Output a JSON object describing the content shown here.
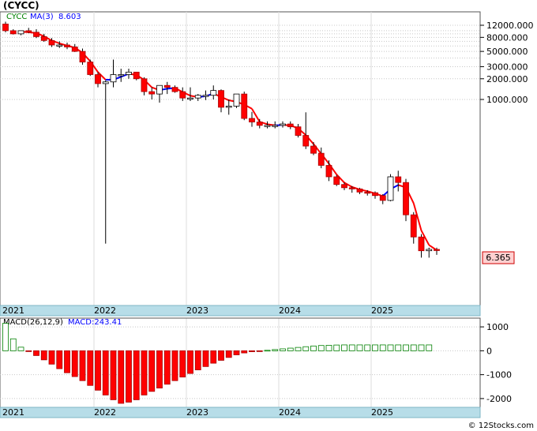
{
  "header": {
    "title": "(CYCC)"
  },
  "legend": {
    "ticker": "CYCC",
    "ma_label": "MA(3)",
    "ma_value": "8.603"
  },
  "price_panel": {
    "last_price_label": "6.365",
    "yaxis_labels": [
      "12000.000",
      "8000.000",
      "5000.000",
      "3000.000",
      "2000.000",
      "1000.000"
    ]
  },
  "macd_panel": {
    "label": "MACD(26,12,9)",
    "value_label": "MACD:243.41",
    "yaxis_labels": [
      "1000",
      "0",
      "-1000",
      "-2000"
    ]
  },
  "year_labels": [
    "2021",
    "2022",
    "2023",
    "2024",
    "2025"
  ],
  "footer": {
    "credit": "© 12Stocks.com"
  },
  "colors": {
    "up": "#ffffff",
    "down": "#ff0000",
    "ma_up": "#0000ff",
    "ma_down": "#ff0000",
    "macd_pos": "#008000",
    "macd_neg": "#ff0000",
    "year_bar": "#b7dde8"
  },
  "chart_data": [
    {
      "type": "candlestick",
      "title": "(CYCC)",
      "scale": "log",
      "period": "monthly",
      "x": [
        "2021-01",
        "2021-02",
        "2021-03",
        "2021-04",
        "2021-05",
        "2021-06",
        "2021-07",
        "2021-08",
        "2021-09",
        "2021-10",
        "2021-11",
        "2021-12",
        "2022-01",
        "2022-02",
        "2022-03",
        "2022-04",
        "2022-05",
        "2022-06",
        "2022-07",
        "2022-08",
        "2022-09",
        "2022-10",
        "2022-11",
        "2022-12",
        "2023-01",
        "2023-02",
        "2023-03",
        "2023-04",
        "2023-05",
        "2023-06",
        "2023-07",
        "2023-08",
        "2023-09",
        "2023-10",
        "2023-11",
        "2023-12",
        "2024-01",
        "2024-02",
        "2024-03",
        "2024-04",
        "2024-05",
        "2024-06",
        "2024-07",
        "2024-08",
        "2024-09",
        "2024-10",
        "2024-11",
        "2024-12",
        "2025-01",
        "2025-02",
        "2025-03",
        "2025-04",
        "2025-05",
        "2025-06",
        "2025-07",
        "2025-08",
        "2025-09",
        "2025-10",
        "2025-11",
        "2025-12",
        "2026-01"
      ],
      "open": [
        12500,
        10000,
        9000,
        10000,
        9500,
        8200,
        7200,
        6200,
        6200,
        5800,
        5000,
        3500,
        2300,
        1700,
        1800,
        2300,
        2300,
        2500,
        2000,
        1300,
        1200,
        1600,
        1500,
        1300,
        1050,
        1050,
        1150,
        1150,
        1350,
        770,
        800,
        1200,
        530,
        470,
        420,
        420,
        420,
        440,
        400,
        300,
        210,
        165,
        110,
        75,
        58,
        52,
        50,
        45,
        44,
        40,
        34,
        75,
        62,
        21,
        10,
        6.3,
        6.6
      ],
      "high": [
        13500,
        10500,
        10000,
        11000,
        10500,
        9000,
        7800,
        7000,
        6700,
        6400,
        5500,
        3800,
        2500,
        1900,
        3800,
        2800,
        2800,
        2500,
        2100,
        1500,
        1400,
        1800,
        1600,
        1500,
        1500,
        1200,
        1350,
        1600,
        1400,
        1000,
        900,
        1300,
        660,
        520,
        480,
        480,
        480,
        480,
        440,
        650,
        240,
        200,
        130,
        80,
        62,
        55,
        52,
        48,
        46,
        42,
        82,
        92,
        70,
        23,
        11,
        7,
        7
      ],
      "low": [
        9500,
        8800,
        8600,
        9200,
        7800,
        6900,
        5800,
        5600,
        5400,
        4900,
        3200,
        2200,
        1500,
        8,
        1500,
        1800,
        2000,
        1900,
        1150,
        1000,
        900,
        1200,
        1250,
        950,
        950,
        950,
        980,
        1000,
        650,
        600,
        750,
        500,
        400,
        380,
        380,
        380,
        390,
        370,
        280,
        190,
        155,
        100,
        65,
        55,
        48,
        44,
        42,
        40,
        36,
        30,
        33,
        46,
        17,
        8,
        5,
        5,
        5.5
      ],
      "close": [
        10000,
        9000,
        10000,
        9500,
        8200,
        7200,
        6200,
        6200,
        5800,
        5000,
        3500,
        2300,
        1700,
        1800,
        2300,
        2300,
        2500,
        2000,
        1300,
        1200,
        1600,
        1500,
        1300,
        1050,
        1050,
        1150,
        1150,
        1350,
        770,
        800,
        1200,
        530,
        470,
        420,
        420,
        420,
        440,
        400,
        300,
        210,
        165,
        110,
        75,
        58,
        52,
        50,
        45,
        44,
        40,
        34,
        75,
        62,
        21,
        10,
        6.3,
        6.6,
        6.365
      ],
      "ma_label": "MA(3)",
      "ma_last": 8.603,
      "last": 6.365,
      "yticks": [
        12000,
        8000,
        5000,
        3000,
        2000,
        1000
      ]
    },
    {
      "type": "bar",
      "title": "MACD(26,12,9)",
      "macd": 243.41,
      "values": [
        1150,
        500,
        150,
        -20,
        -200,
        -380,
        -560,
        -750,
        -920,
        -1080,
        -1250,
        -1450,
        -1650,
        -1850,
        -2050,
        -2200,
        -2150,
        -2050,
        -1850,
        -1700,
        -1560,
        -1400,
        -1250,
        -1100,
        -950,
        -800,
        -660,
        -520,
        -400,
        -280,
        -170,
        -90,
        -40,
        -10,
        20,
        50,
        80,
        110,
        140,
        170,
        200,
        220,
        230,
        240,
        245,
        245,
        245,
        245,
        245,
        245,
        245,
        245,
        245,
        245,
        245,
        245
      ],
      "yticks": [
        1000,
        0,
        -1000,
        -2000
      ],
      "ylim": [
        -2300,
        1300
      ]
    }
  ]
}
